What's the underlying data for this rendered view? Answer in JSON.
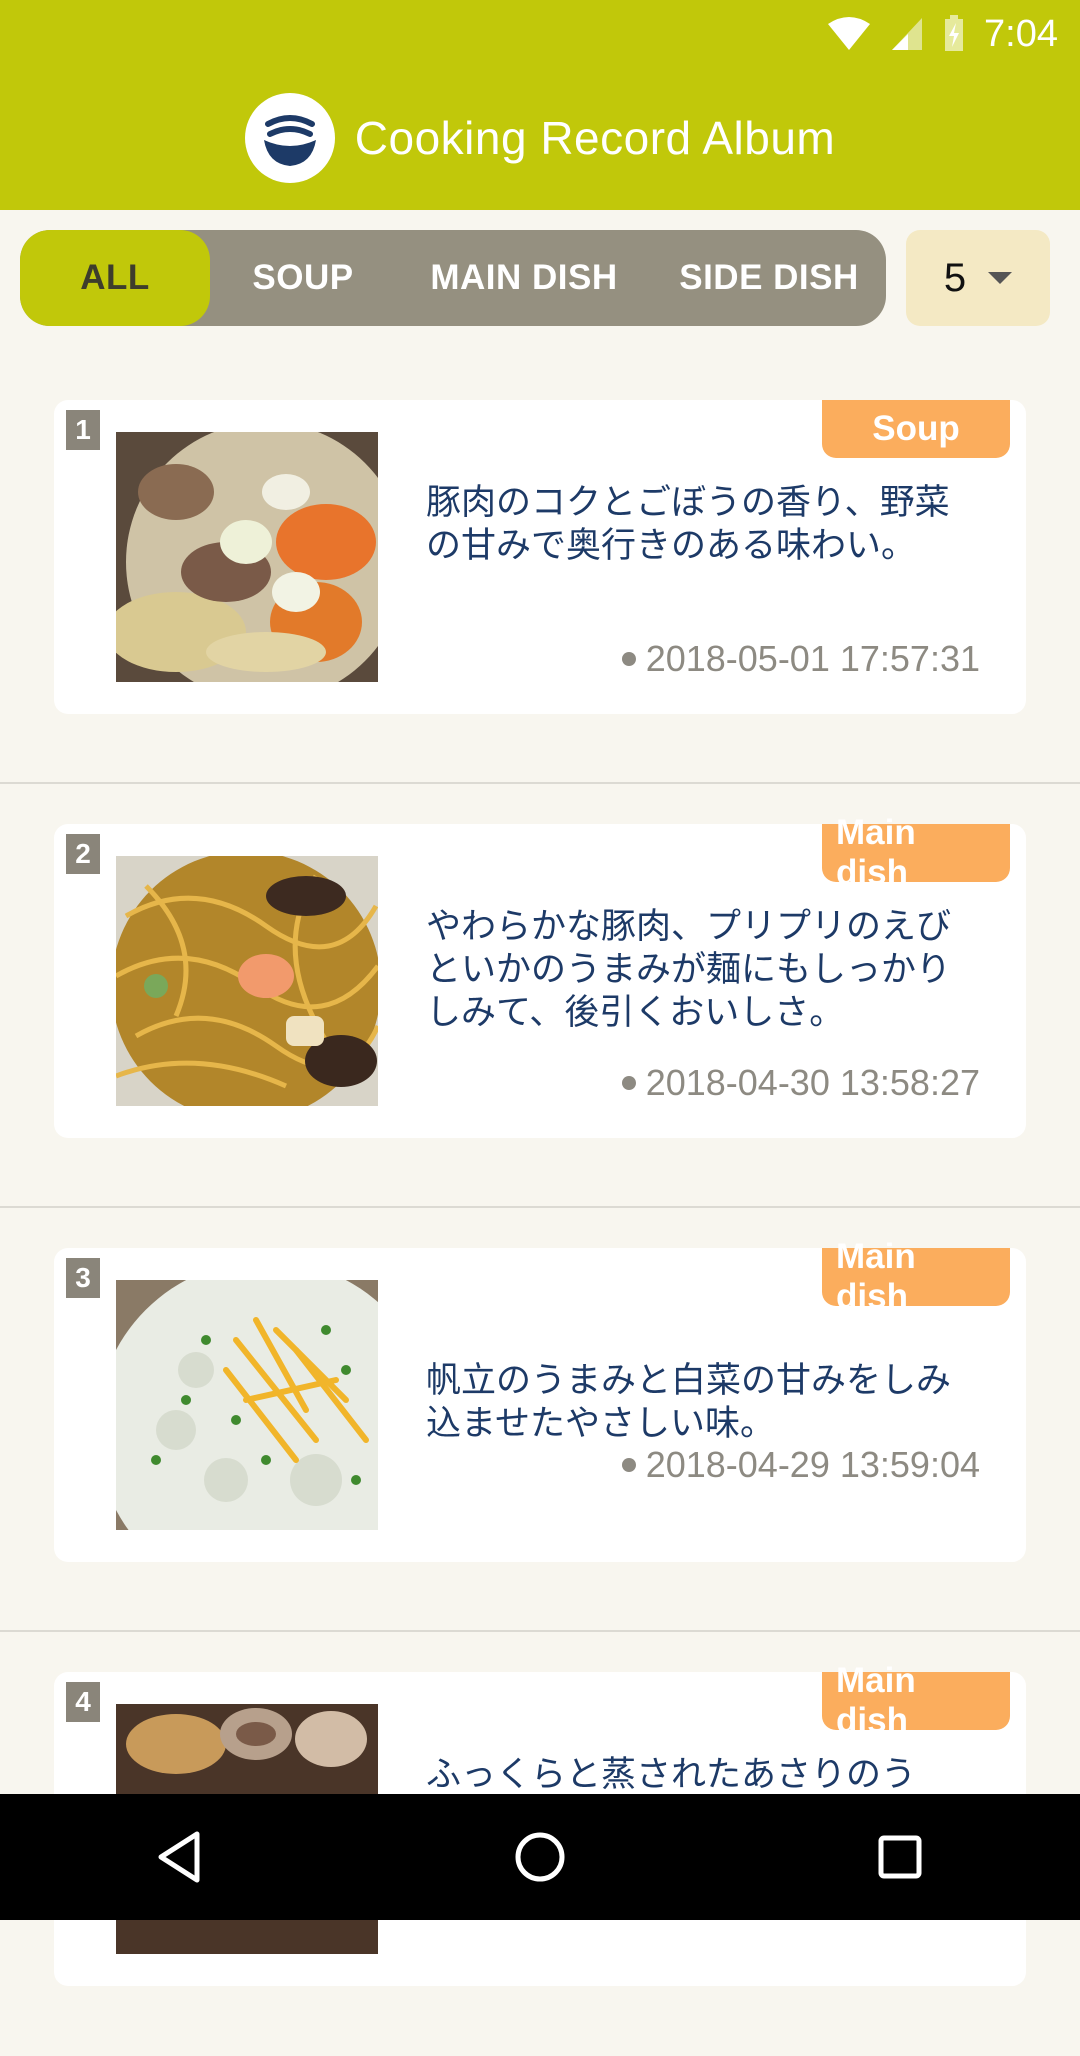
{
  "status_bar": {
    "time": "7:04",
    "icons": [
      "wifi-icon",
      "cell-signal-icon",
      "battery-charging-icon"
    ]
  },
  "app": {
    "title": "Cooking Record Album",
    "logo_icon": "bowl-logo-icon"
  },
  "filters": {
    "tabs": [
      {
        "label": "ALL",
        "active": true
      },
      {
        "label": "SOUP",
        "active": false
      },
      {
        "label": "MAIN DISH",
        "active": false
      },
      {
        "label": "SIDE DISH",
        "active": false
      }
    ],
    "count_selected": "5"
  },
  "recipes": [
    {
      "rank": "1",
      "category": "Soup",
      "description": "豚肉のコクとごぼうの香り、野菜の甘みで奥行きのある味わい。",
      "timestamp": "2018-05-01 17:57:31"
    },
    {
      "rank": "2",
      "category": "Main dish",
      "description": "やわらかな豚肉、プリプリのえびといかのうまみが麺にもしっかりしみて、後引くおいしさ。",
      "timestamp": "2018-04-30 13:58:27"
    },
    {
      "rank": "3",
      "category": "Main dish",
      "description": "帆立のうまみと白菜の甘みをしみ込ませたやさしい味。",
      "timestamp": "2018-04-29 13:59:04"
    },
    {
      "rank": "4",
      "category": "Main dish",
      "description": "ふっくらと蒸されたあさりのう",
      "timestamp": ""
    }
  ],
  "colors": {
    "appbar": "#c1c80a",
    "tab_bg": "#959080",
    "badge": "#fbad5d",
    "text_primary": "#1d3a67"
  },
  "nav": {
    "icons": [
      "back-icon",
      "home-icon",
      "recents-icon"
    ]
  }
}
